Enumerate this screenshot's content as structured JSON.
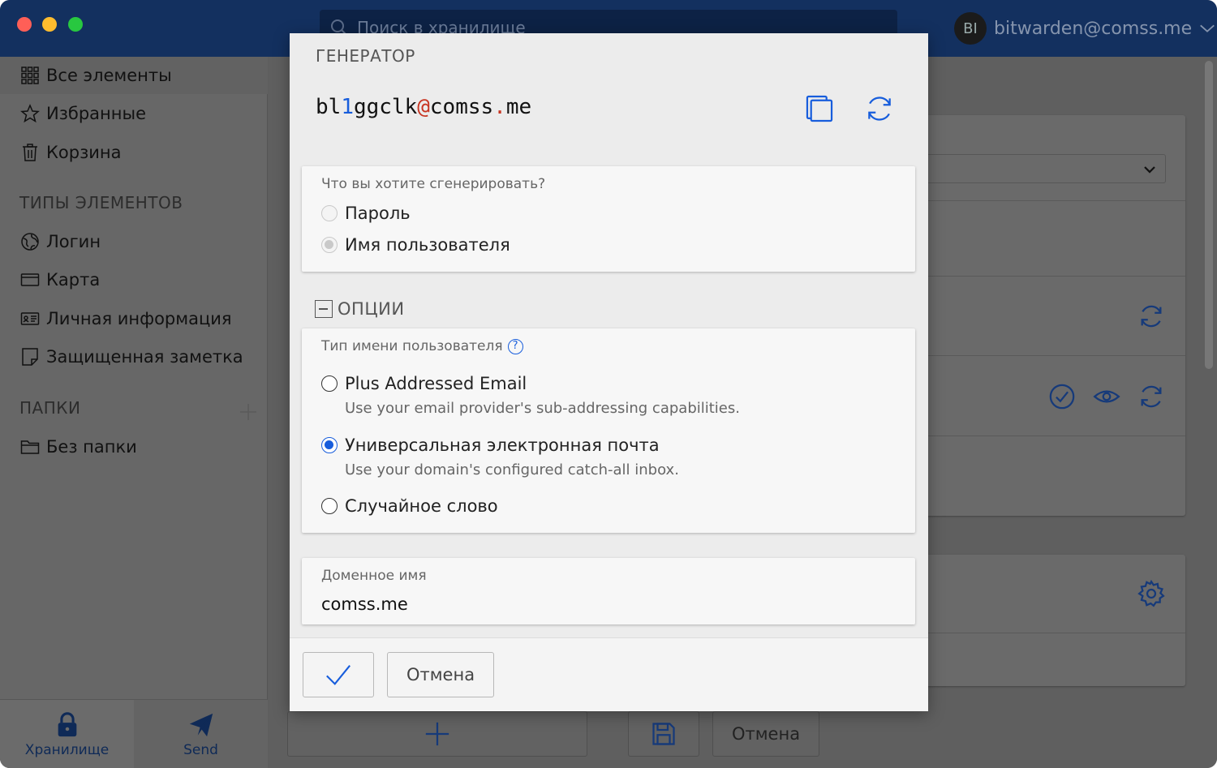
{
  "search": {
    "placeholder": "Поиск в хранилище"
  },
  "account": {
    "initials": "BI",
    "email": "bitwarden@comss.me"
  },
  "sidebar": {
    "items": [
      {
        "label": "Все элементы"
      },
      {
        "label": "Избранные"
      },
      {
        "label": "Корзина"
      }
    ],
    "types_header": "ТИПЫ ЭЛЕМЕНТОВ",
    "types": [
      {
        "label": "Логин"
      },
      {
        "label": "Карта"
      },
      {
        "label": "Личная информация"
      },
      {
        "label": "Защищенная заметка"
      }
    ],
    "folders_header": "ПАПКИ",
    "folders": [
      {
        "label": "Без папки"
      }
    ]
  },
  "bottomnav": {
    "vault_label": "Хранилище",
    "send_label": "Send"
  },
  "background": {
    "cancel_label": "Отмена"
  },
  "modal": {
    "title": "ГЕНЕРАТОР",
    "generated": {
      "part1": "bl",
      "num": "1",
      "part2": "ggclk",
      "at": "@",
      "part3": "comss",
      "dot": ".",
      "part4": "me"
    },
    "what_label": "Что вы хотите сгенерировать?",
    "what_options": [
      {
        "label": "Пароль",
        "checked": false
      },
      {
        "label": "Имя пользователя",
        "checked": true
      }
    ],
    "options_header": "ОПЦИИ",
    "username_type_label": "Тип имени пользователя",
    "username_types": [
      {
        "label": "Plus Addressed Email",
        "desc": "Use your email provider's sub-addressing capabilities.",
        "checked": false
      },
      {
        "label": "Универсальная электронная почта",
        "desc": "Use your domain's configured catch-all inbox.",
        "checked": true
      },
      {
        "label": "Случайное слово",
        "desc": "",
        "checked": false
      }
    ],
    "domain_label": "Доменное имя",
    "domain_value": "comss.me",
    "cancel_label": "Отмена"
  },
  "colors": {
    "accent": "#175ddc",
    "header": "#13305f",
    "special_char": "#c83522"
  }
}
